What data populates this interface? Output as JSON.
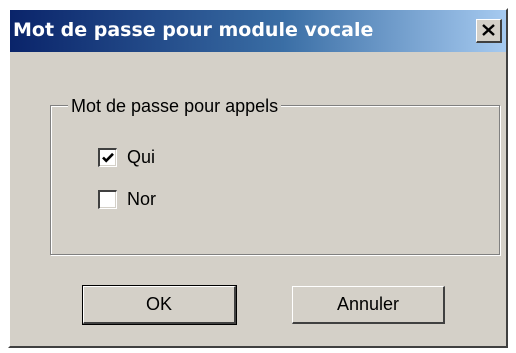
{
  "dialog": {
    "title": "Mot de passe pour module vocale",
    "close_icon": "close-icon"
  },
  "group": {
    "label": "Mot de passe pour appels",
    "options": [
      {
        "label": "Qui",
        "checked": true
      },
      {
        "label": "Nor",
        "checked": false
      }
    ]
  },
  "buttons": {
    "ok_label": "OK",
    "cancel_label": "Annuler"
  }
}
